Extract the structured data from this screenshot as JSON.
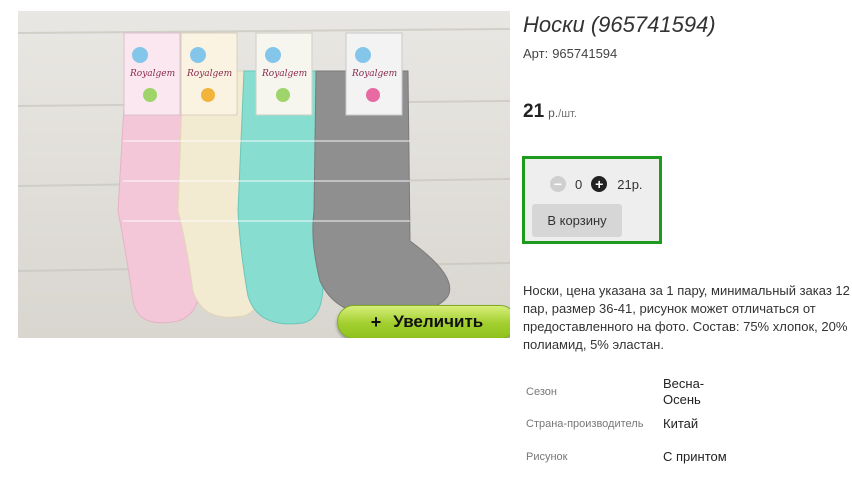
{
  "product": {
    "title": "Носки (965741594)",
    "sku_label": "Арт:",
    "sku_value": "965741594",
    "price_amount": "21",
    "price_currency": "р.",
    "price_per": "/шт.",
    "image_alt": "Носки",
    "sock_brand": "Royalgem",
    "sock_colors": [
      "#f3c7d8",
      "#f3ead2",
      "#86ddd0",
      "#8f8f8f"
    ]
  },
  "zoom_button": {
    "icon": "+",
    "label": "Увеличить"
  },
  "buybox": {
    "minus_icon": "−",
    "quantity": "0",
    "plus_icon": "+",
    "total": "21р.",
    "cart_label": "В корзину",
    "border_color": "#1e9a1e"
  },
  "description": "Носки, цена указана за 1 пару, минимальный заказ 12 пар, размер 36-41, рисунок может отличаться от предоставленного на фото. Состав: 75% хлопок, 20% полиамид, 5% эластан.",
  "properties": [
    {
      "key": "Сезон",
      "value": "Весна-Осень"
    },
    {
      "key": "Страна-производитель",
      "value": "Китай"
    },
    {
      "key": "Рисунок",
      "value": "С принтом"
    }
  ]
}
